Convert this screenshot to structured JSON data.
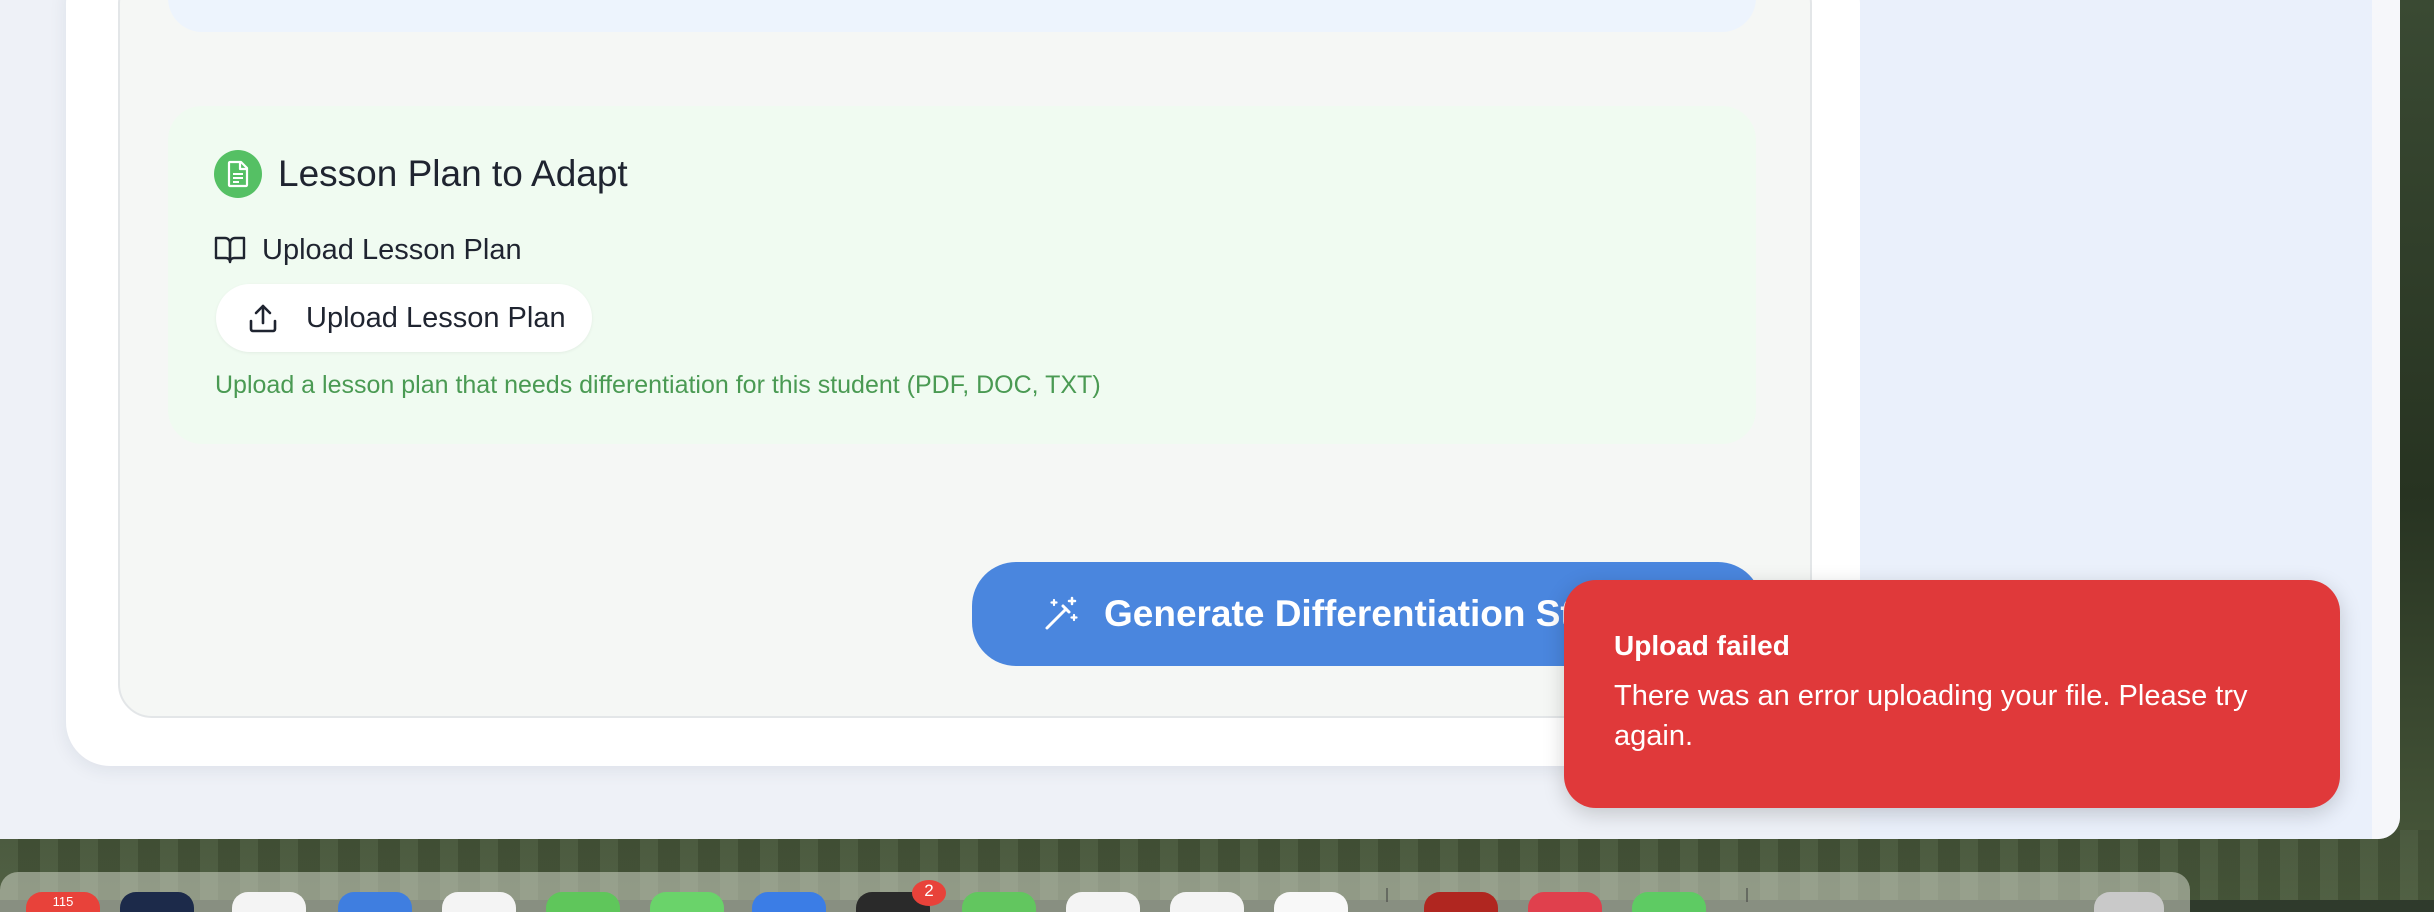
{
  "lesson_section": {
    "title": "Lesson Plan to Adapt",
    "upload_label": "Upload Lesson Plan",
    "upload_button_label": "Upload Lesson Plan",
    "helper_text": "Upload a lesson plan that needs differentiation for this student (PDF, DOC, TXT)",
    "accent_color": "#55c064"
  },
  "generate_button": {
    "label": "Generate Differentiation Strategies",
    "color": "#4a86de"
  },
  "toast": {
    "title": "Upload failed",
    "message": "There was an error uploading your file. Please try again.",
    "color": "#e0393a"
  },
  "dock": {
    "badge_count": "2",
    "left_badge": "115"
  },
  "icons": {
    "section": "document-icon",
    "label": "book-open-icon",
    "upload": "upload-icon",
    "generate": "magic-wand-icon",
    "side": "cloud-icon"
  }
}
